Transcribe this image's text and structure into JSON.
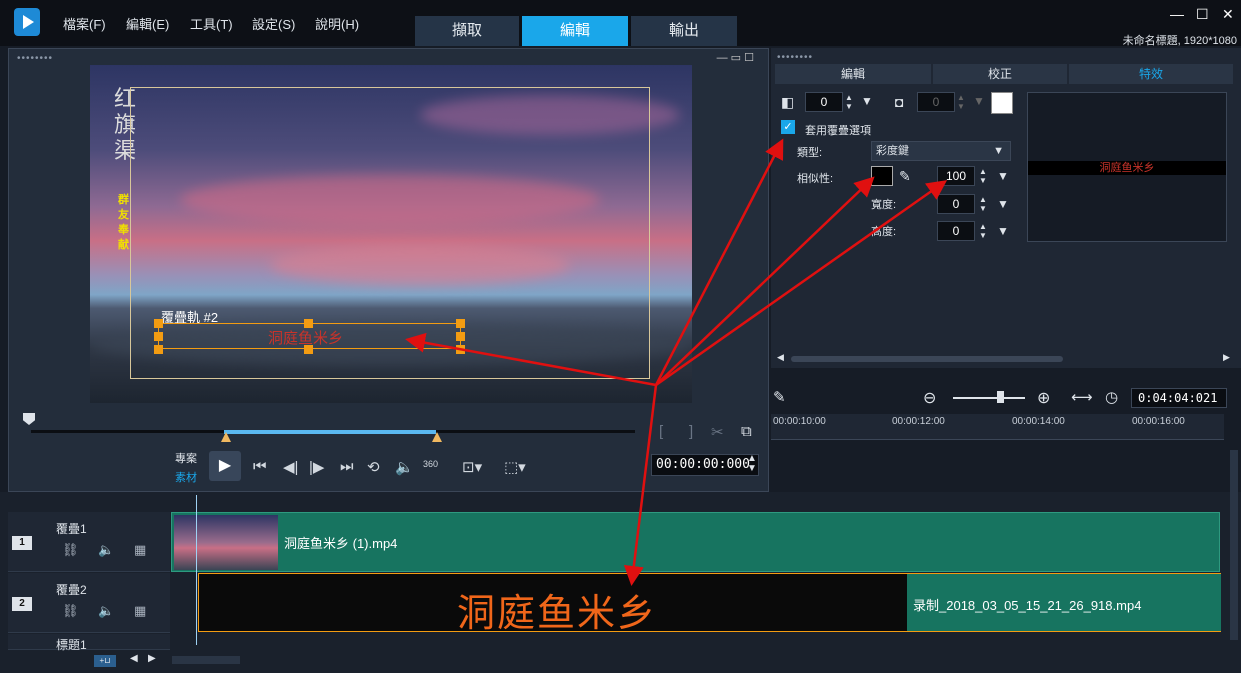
{
  "menubar": {
    "items": [
      "檔案(F)",
      "編輯(E)",
      "工具(T)",
      "設定(S)",
      "說明(H)"
    ]
  },
  "workspace_tabs": [
    {
      "label": "擷取"
    },
    {
      "label": "編輯",
      "active": true
    },
    {
      "label": "輸出"
    }
  ],
  "window": {
    "title": "未命名標題, 1920*1080",
    "controls": [
      "—",
      "☐",
      "✕"
    ]
  },
  "preview": {
    "overlay_track_label": "覆疊軌 #2",
    "overlay_text": "洞庭鱼米乡",
    "watermark_big": "红旗渠",
    "watermark_small": "群友奉献",
    "mode_project": "專案",
    "mode_clip": "素材",
    "timecode": "00:00:00:000",
    "icon_360": "360"
  },
  "settings": {
    "tabs": [
      {
        "label": "編輯"
      },
      {
        "label": "校正"
      },
      {
        "label": "特效",
        "active": true
      }
    ],
    "opacity_value": "0",
    "border_value": "0",
    "apply_overlay_label": "套用覆疊選項",
    "type_label": "類型:",
    "type_value": "彩度鍵",
    "similarity_label": "相似性:",
    "similarity_value": "100",
    "width_label": "寬度:",
    "width_value": "0",
    "height_label": "高度:",
    "height_value": "0",
    "thumb_text": "洞庭鱼米乡"
  },
  "timeline": {
    "ruler_ticks": [
      "00:00:10:00",
      "00:00:12:00",
      "00:00:14:00",
      "00:00:16:00"
    ],
    "display_timecode": "0:04:04:021",
    "tracks": [
      {
        "number": "1",
        "name": "覆疊1",
        "clip_name": "洞庭鱼米乡 (1).mp4"
      },
      {
        "number": "2",
        "name": "覆疊2",
        "clip_title": "洞庭鱼米乡",
        "clip_name": "录制_2018_03_05_15_21_26_918.mp4"
      },
      {
        "name": "標題1"
      }
    ]
  },
  "colors": {
    "accent": "#1aa7ea",
    "clip_teal": "#177460",
    "overlay_orange": "#f39c12",
    "annotation_red": "#e01010"
  }
}
